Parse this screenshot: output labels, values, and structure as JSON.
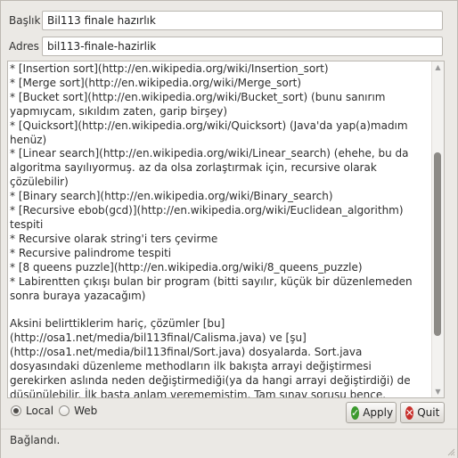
{
  "form": {
    "title_label": "Başlık",
    "title_value": "Bil113 finale hazırlık",
    "address_label": "Adres",
    "address_value": "bil113-finale-hazirlik"
  },
  "editor": {
    "content": "* [Insertion sort](http://en.wikipedia.org/wiki/Insertion_sort)\n* [Merge sort](http://en.wikipedia.org/wiki/Merge_sort)\n* [Bucket sort](http://en.wikipedia.org/wiki/Bucket_sort) (bunu sanırım yapmıycam, sıkıldım zaten, garip birşey)\n* [Quicksort](http://en.wikipedia.org/wiki/Quicksort) (Java'da yap(a)madım henüz)\n* [Linear search](http://en.wikipedia.org/wiki/Linear_search) (ehehe, bu da algoritma sayılıyormuş. az da olsa zorlaştırmak için, recursive olarak çözülebilir)\n* [Binary search](http://en.wikipedia.org/wiki/Binary_search)\n* [Recursive ebob(gcd)](http://en.wikipedia.org/wiki/Euclidean_algorithm) tespiti\n* Recursive olarak string'i ters çevirme\n* Recursive palindrome tespiti\n* [8 queens puzzle](http://en.wikipedia.org/wiki/8_queens_puzzle)\n* Labirentten çıkışı bulan bir program (bitti sayılır, küçük bir düzenlemeden sonra buraya yazacağım)\n\nAksini belirttiklerim hariç, çözümler [bu](http://osa1.net/media/bil113final/Calisma.java) ve [şu](http://osa1.net/media/bil113final/Sort.java) dosyalarda. Sort.java dosyasındaki düzenleme methodların ilk bakışta arrayi değiştirmesi gerekirken aslında neden değiştirmediği(ya da hangi arrayi değiştirdiği) de düşünülebilir. İlk başta anlam verememiştim. Tam sınav sorusu bence.\n\nBunların dışında, codingbat'deki sorular güzel. Hepsi bittikten sonra çözümlerini yazacağım buraya.\n\nBu arada, biraz konu dışı olacak ama, Python'da tek satırda quicksort, ibretlik:"
  },
  "radios": [
    {
      "label": "Local",
      "checked": true
    },
    {
      "label": "Web",
      "checked": false
    }
  ],
  "buttons": {
    "apply_label": "Apply",
    "quit_label": "Quit",
    "apply_color": "#3c9a2e",
    "quit_color": "#c8302c"
  },
  "status": {
    "text": "Bağlandı."
  }
}
